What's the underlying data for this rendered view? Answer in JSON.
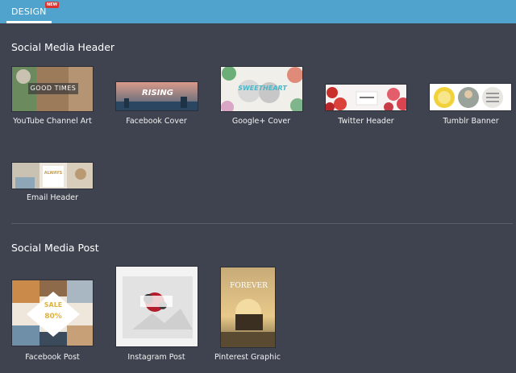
{
  "topbar": {
    "tab_label": "DESIGN",
    "badge": "NEW",
    "color": "#4fa3cc"
  },
  "sections": {
    "header": {
      "title": "Social Media Header"
    },
    "post": {
      "title": "Social Media Post"
    }
  },
  "header_tiles": [
    {
      "label": "YouTube Channel Art",
      "thumb_text": "GOOD TIMES"
    },
    {
      "label": "Facebook Cover",
      "thumb_text": "RISING"
    },
    {
      "label": "Google+ Cover",
      "thumb_text": "SWEETHEART"
    },
    {
      "label": "Twitter Header",
      "thumb_text": ""
    },
    {
      "label": "Tumblr Banner",
      "thumb_text": ""
    },
    {
      "label": "Email Header",
      "thumb_text": "ALWAYS"
    }
  ],
  "post_tiles": [
    {
      "label": "Facebook Post",
      "thumb_text": "SALE",
      "thumb_text2": "80%"
    },
    {
      "label": "Instagram Post",
      "thumb_text": ""
    },
    {
      "label": "Pinterest Graphic",
      "thumb_text": "FOREVER"
    }
  ]
}
